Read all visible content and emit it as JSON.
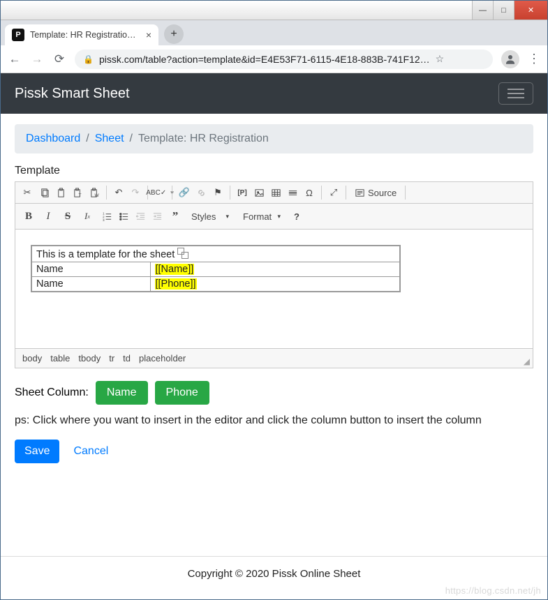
{
  "window": {
    "tab_title": "Template: HR Registration - S",
    "favicon_letter": "P",
    "url_display": "pissk.com/table?action=template&id=E4E53F71-6115-4E18-883B-741F12…"
  },
  "navbar": {
    "brand": "Pissk Smart Sheet"
  },
  "breadcrumb": {
    "dashboard": "Dashboard",
    "sheet": "Sheet",
    "current": "Template: HR Registration",
    "sep": "/"
  },
  "label_template": "Template",
  "editor": {
    "toolbar": {
      "source": "Source",
      "styles": "Styles",
      "format": "Format"
    },
    "table": {
      "row1": {
        "c1": "This is a template for the sheet"
      },
      "row2": {
        "c1": "Name",
        "c2": "[[Name]]"
      },
      "row3": {
        "c1": "Name",
        "c2": "[[Phone]]"
      }
    },
    "path": {
      "p0": "body",
      "p1": "table",
      "p2": "tbody",
      "p3": "tr",
      "p4": "td",
      "p5": "placeholder"
    }
  },
  "sheet_column": {
    "label": "Sheet Column:",
    "c0": "Name",
    "c1": "Phone"
  },
  "hint": "ps: Click where you want to insert in the editor and click the column button to insert the column",
  "actions": {
    "save": "Save",
    "cancel": "Cancel"
  },
  "footer": "Copyright © 2020 Pissk Online Sheet",
  "watermark": "https://blog.csdn.net/jh"
}
